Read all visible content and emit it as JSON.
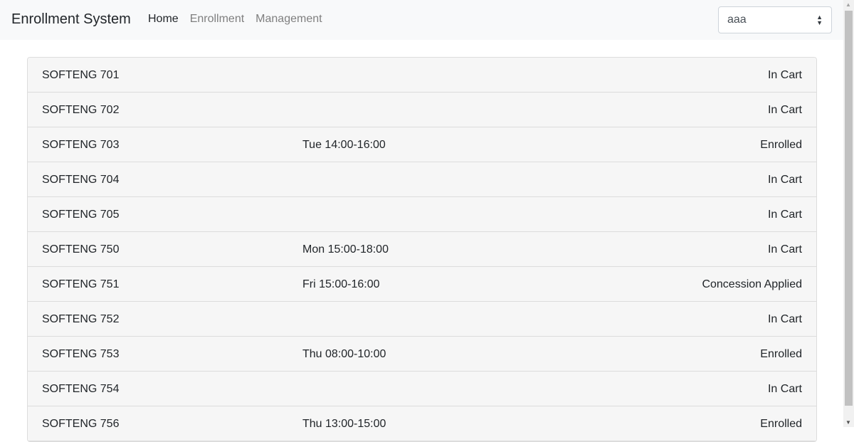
{
  "navbar": {
    "brand": "Enrollment System",
    "links": [
      {
        "label": "Home",
        "active": true
      },
      {
        "label": "Enrollment",
        "active": false
      },
      {
        "label": "Management",
        "active": false
      }
    ],
    "user_select": {
      "value": "aaa"
    }
  },
  "courses": [
    {
      "code": "SOFTENG 701",
      "time": "",
      "status": "In Cart"
    },
    {
      "code": "SOFTENG 702",
      "time": "",
      "status": "In Cart"
    },
    {
      "code": "SOFTENG 703",
      "time": "Tue 14:00-16:00",
      "status": "Enrolled"
    },
    {
      "code": "SOFTENG 704",
      "time": "",
      "status": "In Cart"
    },
    {
      "code": "SOFTENG 705",
      "time": "",
      "status": "In Cart"
    },
    {
      "code": "SOFTENG 750",
      "time": "Mon 15:00-18:00",
      "status": "In Cart"
    },
    {
      "code": "SOFTENG 751",
      "time": "Fri 15:00-16:00",
      "status": "Concession Applied"
    },
    {
      "code": "SOFTENG 752",
      "time": "",
      "status": "In Cart"
    },
    {
      "code": "SOFTENG 753",
      "time": "Thu 08:00-10:00",
      "status": "Enrolled"
    },
    {
      "code": "SOFTENG 754",
      "time": "",
      "status": "In Cart"
    },
    {
      "code": "SOFTENG 756",
      "time": "Thu 13:00-15:00",
      "status": "Enrolled"
    }
  ]
}
